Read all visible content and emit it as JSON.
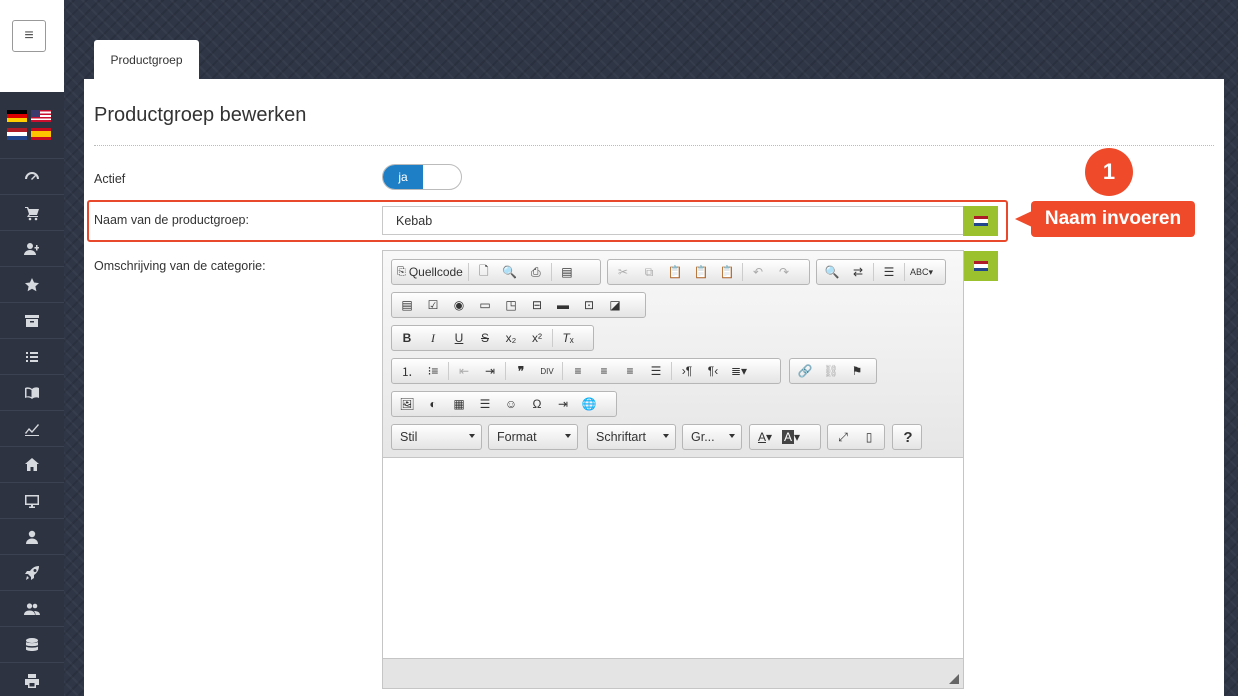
{
  "tab": {
    "label": "Productgroep"
  },
  "page": {
    "title": "Productgroep bewerken"
  },
  "form": {
    "active_label": "Actief",
    "active_value": "ja",
    "name_label": "Naam van de productgroep:",
    "name_value": "Kebab",
    "description_label": "Omschrijving van de categorie:"
  },
  "callout": {
    "number": "1",
    "text": "Naam invoeren"
  },
  "editor": {
    "source_label": "Quellcode",
    "style_combo": "Stil",
    "format_combo": "Format",
    "font_combo": "Schriftart",
    "size_combo": "Gr...",
    "help_label": "?"
  },
  "sidebar": {
    "icons": [
      "dashboard-icon",
      "cart-icon",
      "user-plus-icon",
      "star-icon",
      "archive-icon",
      "list-icon",
      "book-icon",
      "chart-icon",
      "home-icon",
      "monitor-icon",
      "user-icon",
      "rocket-icon",
      "users-icon",
      "database-icon",
      "printer-icon"
    ]
  },
  "colors": {
    "accent_blue": "#1f7fc6",
    "lang_green": "#9bc12e",
    "callout_red": "#ef4b2b"
  }
}
